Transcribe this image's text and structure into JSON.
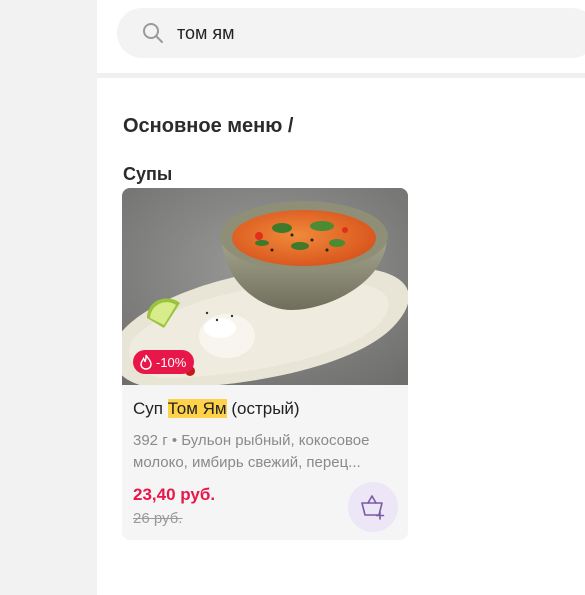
{
  "search": {
    "value": "том ям"
  },
  "main": {
    "section_title": "Основное меню /",
    "category_title": "Супы"
  },
  "product": {
    "name_prefix": "Суп ",
    "name_highlight": "Том Ям",
    "name_suffix": " (острый)",
    "description_line1": "392 г • Бульон рыбный, кокосовое",
    "description_line2": "молоко, имбирь свежий, перец...",
    "discount": "-10%",
    "price_new": "23,40 руб.",
    "price_old": "26 руб."
  },
  "icons": {
    "search": "search-icon",
    "flame": "flame-icon",
    "cart": "basket-plus-icon"
  },
  "colors": {
    "accent_red": "#e8174a",
    "highlight": "#ffd24a",
    "cart_bg": "#ece6f6",
    "cart_icon": "#7a5aa6"
  }
}
